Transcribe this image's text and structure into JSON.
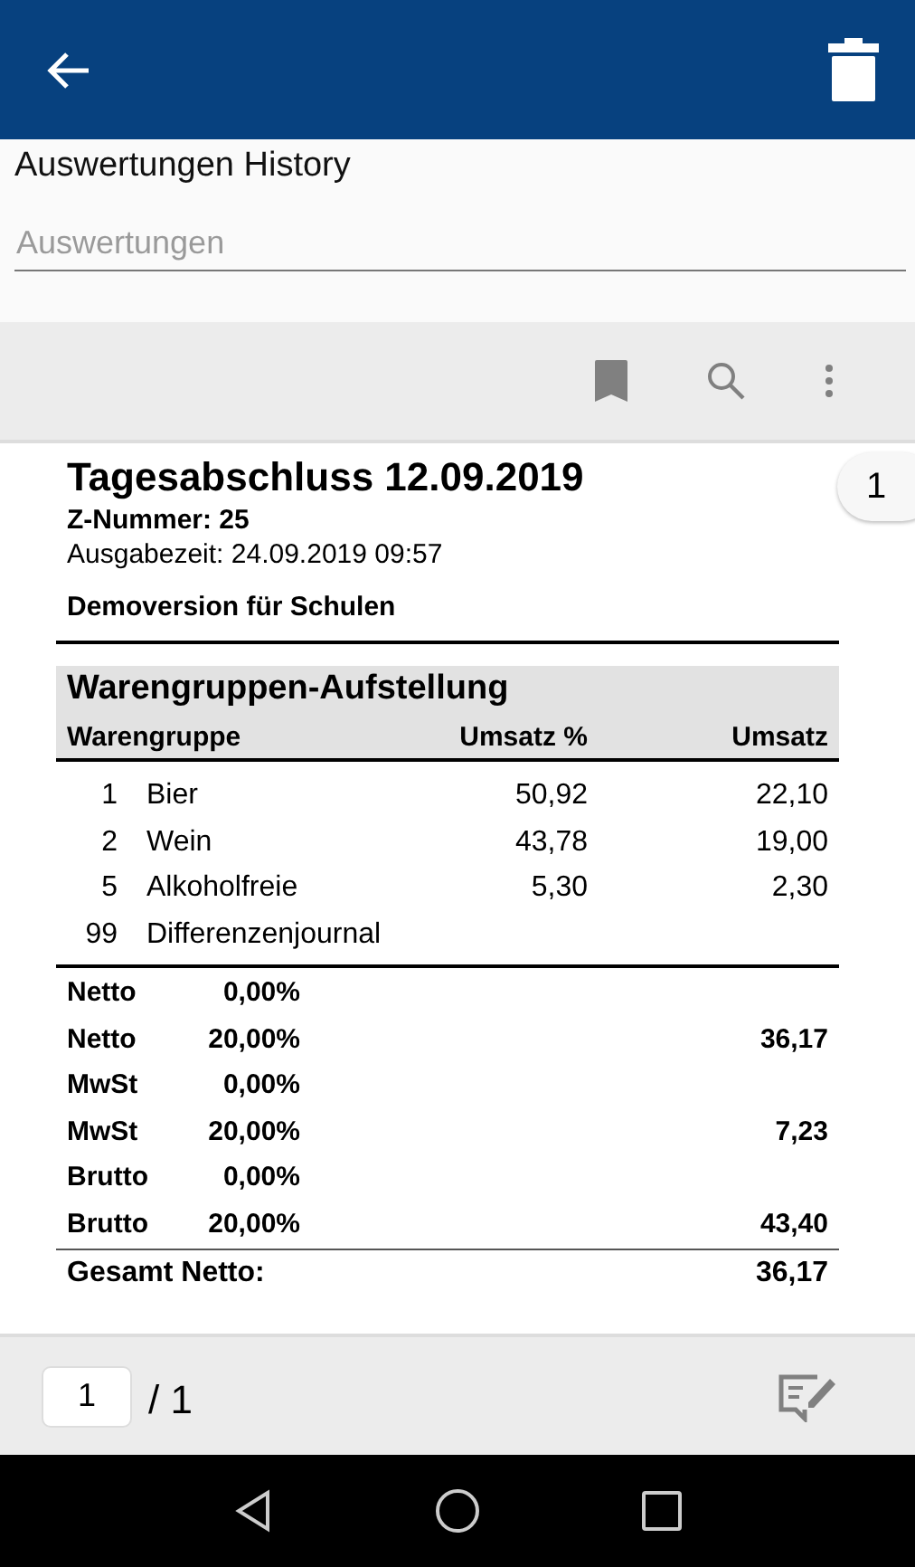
{
  "header": {
    "title": "Auswertungen History",
    "field": {
      "placeholder": "Auswertungen"
    }
  },
  "report": {
    "title": "Tagesabschluss 12.09.2019",
    "z_number": "Z-Nummer: 25",
    "issued": "Ausgabezeit: 24.09.2019 09:57",
    "subtitle": "Demoversion für Schulen",
    "section": "Warengruppen-Aufstellung",
    "columns": [
      "Warengruppe",
      "Umsatz %",
      "Umsatz"
    ],
    "rows": [
      {
        "no": "1",
        "name": "Bier",
        "percent": "50,92",
        "amount": "22,10"
      },
      {
        "no": "2",
        "name": "Wein",
        "percent": "43,78",
        "amount": "19,00"
      },
      {
        "no": "5",
        "name": "Alkoholfreie",
        "percent": "5,30",
        "amount": "2,30"
      },
      {
        "no": "99",
        "name": "Differenzenjournal"
      }
    ],
    "tax_rows": [
      {
        "label": "Netto",
        "rate": "0,00%"
      },
      {
        "label": "Netto",
        "rate": "20,00%",
        "amount": "36,17"
      },
      {
        "label": "MwSt",
        "rate": "0,00%"
      },
      {
        "label": "MwSt",
        "rate": "20,00%",
        "amount": "7,23"
      },
      {
        "label": "Brutto",
        "rate": "0,00%"
      },
      {
        "label": "Brutto",
        "rate": "20,00%",
        "amount": "43,40"
      }
    ],
    "totals": [
      {
        "label": "Gesamt Netto:",
        "amount": "36,17"
      }
    ]
  },
  "page_badge": "1",
  "pager": {
    "value": "1",
    "total": "/ 1"
  }
}
